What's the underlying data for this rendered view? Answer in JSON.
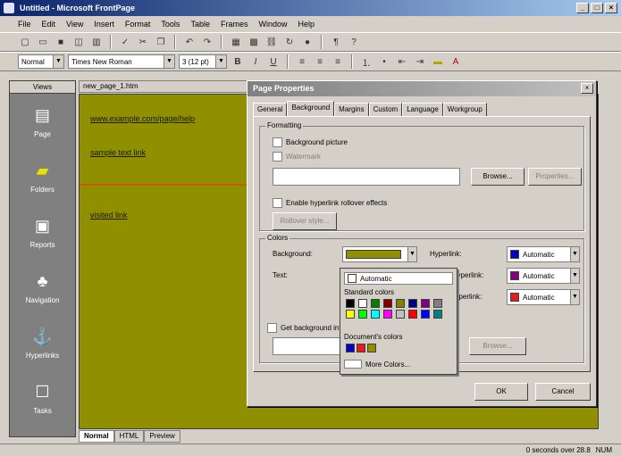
{
  "window": {
    "title": "Untitled - Microsoft FrontPage",
    "minimize": "_",
    "maximize": "□",
    "close": "×"
  },
  "menu": [
    "File",
    "Edit",
    "View",
    "Insert",
    "Format",
    "Tools",
    "Table",
    "Frames",
    "Window",
    "Help"
  ],
  "toolbar2": {
    "style": "Normal",
    "font": "Times New Roman",
    "size": "3 (12 pt)"
  },
  "sidebar": {
    "header": "Views",
    "items": [
      {
        "label": "Page",
        "icon": "▤"
      },
      {
        "label": "Folders",
        "icon": "▰"
      },
      {
        "label": "Reports",
        "icon": "▣"
      },
      {
        "label": "Navigation",
        "icon": "♣"
      },
      {
        "label": "Hyperlinks",
        "icon": "⚓"
      },
      {
        "label": "Tasks",
        "icon": "☐"
      }
    ]
  },
  "doc_tab": "new_page_1.htm",
  "editor": {
    "line1": "www.example.com/page/help",
    "line2": "sample text link",
    "line3": "visited link"
  },
  "bottom_tabs": [
    "Normal",
    "HTML",
    "Preview"
  ],
  "status": {
    "speed": "0 seconds over 28.8",
    "mode": "NUM"
  },
  "dialog": {
    "title": "Page Properties",
    "close": "×",
    "tabs": [
      "General",
      "Background",
      "Margins",
      "Custom",
      "Language",
      "Workgroup"
    ],
    "formatting_label": "Formatting",
    "bg_picture_label": "Background picture",
    "watermark_label": "Watermark",
    "browse": "Browse...",
    "properties": "Properties...",
    "rollover_label": "Enable hyperlink rollover effects",
    "rollover_style": "Rollover style...",
    "colors_label": "Colors",
    "background_label": "Background:",
    "text_label": "Text:",
    "hyperlink_label": "Hyperlink:",
    "visited_label": "Visited hyperlink:",
    "active_label": "Active hyperlink:",
    "hyperlink_value": "Automatic",
    "visited_value": "Automatic",
    "active_value": "Automatic",
    "get_bg_label": "Get background information from another page",
    "browse2": "Browse...",
    "ok": "OK",
    "cancel": "Cancel",
    "colors": {
      "background": "#8f8f00",
      "hyperlink": "#0000c0",
      "visited": "#800080",
      "active": "#e02020"
    }
  },
  "popup": {
    "automatic": "Automatic",
    "standard_label": "Standard colors",
    "custom_label": "Document's colors",
    "more_label": "More Colors...",
    "standard_colors": [
      "#000000",
      "#ffffff",
      "#008000",
      "#800000",
      "#808000",
      "#000080",
      "#800080",
      "#808080",
      "#ffff00",
      "#00ff00",
      "#00ffff",
      "#ff00ff",
      "#c0c0c0",
      "#ff0000",
      "#0000ff",
      "#008080"
    ],
    "recent_colors": [
      "#0000c0",
      "#e02020",
      "#8f8f00"
    ]
  }
}
